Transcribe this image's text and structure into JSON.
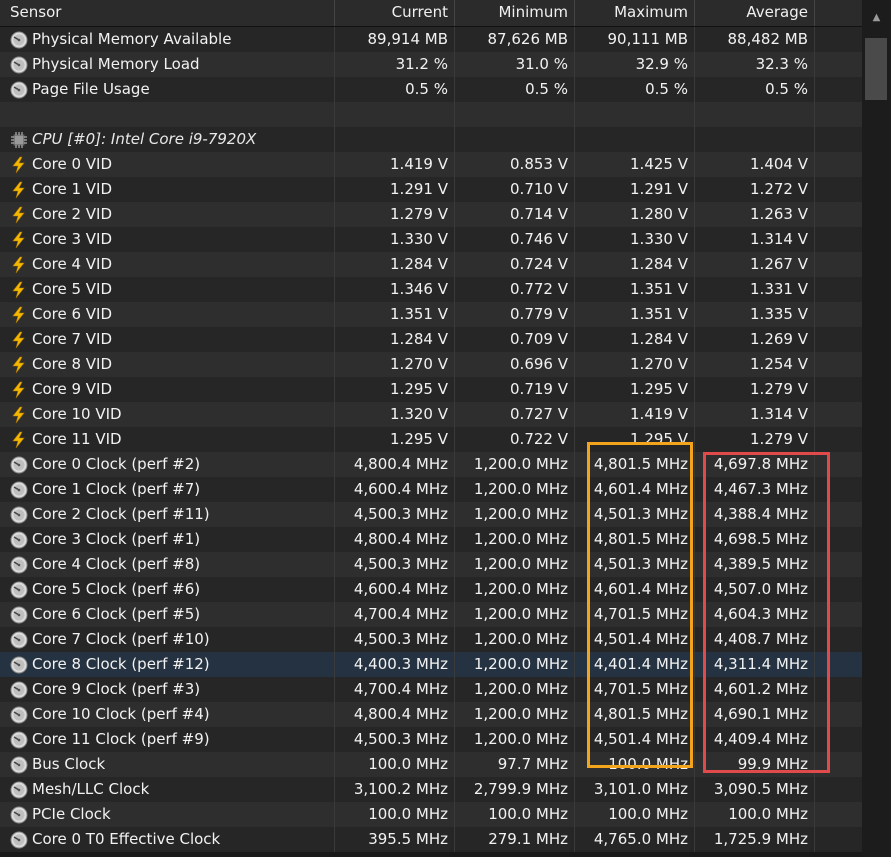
{
  "columns": {
    "sensor": "Sensor",
    "current": "Current",
    "minimum": "Minimum",
    "maximum": "Maximum",
    "average": "Average"
  },
  "colors": {
    "highlight_max": "#f2a51c",
    "highlight_avg": "#e04a4a",
    "selected_row": "#253241"
  },
  "rows": [
    {
      "icon": "gauge-icon",
      "label": "Physical Memory Available",
      "current": "89,914 MB",
      "minimum": "87,626 MB",
      "maximum": "90,111 MB",
      "average": "88,482 MB"
    },
    {
      "icon": "gauge-icon",
      "label": "Physical Memory Load",
      "current": "31.2 %",
      "minimum": "31.0 %",
      "maximum": "32.9 %",
      "average": "32.3 %"
    },
    {
      "icon": "gauge-icon",
      "label": "Page File Usage",
      "current": "0.5 %",
      "minimum": "0.5 %",
      "maximum": "0.5 %",
      "average": "0.5 %"
    },
    {
      "icon": "",
      "label": "",
      "current": "",
      "minimum": "",
      "maximum": "",
      "average": ""
    },
    {
      "icon": "chip-icon",
      "label": "CPU [#0]: Intel Core i9-7920X",
      "current": "",
      "minimum": "",
      "maximum": "",
      "average": "",
      "group": true
    },
    {
      "icon": "bolt-icon",
      "label": "Core 0 VID",
      "current": "1.419 V",
      "minimum": "0.853 V",
      "maximum": "1.425 V",
      "average": "1.404 V"
    },
    {
      "icon": "bolt-icon",
      "label": "Core 1 VID",
      "current": "1.291 V",
      "minimum": "0.710 V",
      "maximum": "1.291 V",
      "average": "1.272 V"
    },
    {
      "icon": "bolt-icon",
      "label": "Core 2 VID",
      "current": "1.279 V",
      "minimum": "0.714 V",
      "maximum": "1.280 V",
      "average": "1.263 V"
    },
    {
      "icon": "bolt-icon",
      "label": "Core 3 VID",
      "current": "1.330 V",
      "minimum": "0.746 V",
      "maximum": "1.330 V",
      "average": "1.314 V"
    },
    {
      "icon": "bolt-icon",
      "label": "Core 4 VID",
      "current": "1.284 V",
      "minimum": "0.724 V",
      "maximum": "1.284 V",
      "average": "1.267 V"
    },
    {
      "icon": "bolt-icon",
      "label": "Core 5 VID",
      "current": "1.346 V",
      "minimum": "0.772 V",
      "maximum": "1.351 V",
      "average": "1.331 V"
    },
    {
      "icon": "bolt-icon",
      "label": "Core 6 VID",
      "current": "1.351 V",
      "minimum": "0.779 V",
      "maximum": "1.351 V",
      "average": "1.335 V"
    },
    {
      "icon": "bolt-icon",
      "label": "Core 7 VID",
      "current": "1.284 V",
      "minimum": "0.709 V",
      "maximum": "1.284 V",
      "average": "1.269 V"
    },
    {
      "icon": "bolt-icon",
      "label": "Core 8 VID",
      "current": "1.270 V",
      "minimum": "0.696 V",
      "maximum": "1.270 V",
      "average": "1.254 V"
    },
    {
      "icon": "bolt-icon",
      "label": "Core 9 VID",
      "current": "1.295 V",
      "minimum": "0.719 V",
      "maximum": "1.295 V",
      "average": "1.279 V"
    },
    {
      "icon": "bolt-icon",
      "label": "Core 10 VID",
      "current": "1.320 V",
      "minimum": "0.727 V",
      "maximum": "1.419 V",
      "average": "1.314 V"
    },
    {
      "icon": "bolt-icon",
      "label": "Core 11 VID",
      "current": "1.295 V",
      "minimum": "0.722 V",
      "maximum": "1.295 V",
      "average": "1.279 V"
    },
    {
      "icon": "gauge-icon",
      "label": "Core 0 Clock (perf #2)",
      "current": "4,800.4 MHz",
      "minimum": "1,200.0 MHz",
      "maximum": "4,801.5 MHz",
      "average": "4,697.8 MHz"
    },
    {
      "icon": "gauge-icon",
      "label": "Core 1 Clock (perf #7)",
      "current": "4,600.4 MHz",
      "minimum": "1,200.0 MHz",
      "maximum": "4,601.4 MHz",
      "average": "4,467.3 MHz"
    },
    {
      "icon": "gauge-icon",
      "label": "Core 2 Clock (perf #11)",
      "current": "4,500.3 MHz",
      "minimum": "1,200.0 MHz",
      "maximum": "4,501.3 MHz",
      "average": "4,388.4 MHz"
    },
    {
      "icon": "gauge-icon",
      "label": "Core 3 Clock (perf #1)",
      "current": "4,800.4 MHz",
      "minimum": "1,200.0 MHz",
      "maximum": "4,801.5 MHz",
      "average": "4,698.5 MHz"
    },
    {
      "icon": "gauge-icon",
      "label": "Core 4 Clock (perf #8)",
      "current": "4,500.3 MHz",
      "minimum": "1,200.0 MHz",
      "maximum": "4,501.3 MHz",
      "average": "4,389.5 MHz"
    },
    {
      "icon": "gauge-icon",
      "label": "Core 5 Clock (perf #6)",
      "current": "4,600.4 MHz",
      "minimum": "1,200.0 MHz",
      "maximum": "4,601.4 MHz",
      "average": "4,507.0 MHz"
    },
    {
      "icon": "gauge-icon",
      "label": "Core 6 Clock (perf #5)",
      "current": "4,700.4 MHz",
      "minimum": "1,200.0 MHz",
      "maximum": "4,701.5 MHz",
      "average": "4,604.3 MHz"
    },
    {
      "icon": "gauge-icon",
      "label": "Core 7 Clock (perf #10)",
      "current": "4,500.3 MHz",
      "minimum": "1,200.0 MHz",
      "maximum": "4,501.4 MHz",
      "average": "4,408.7 MHz"
    },
    {
      "icon": "gauge-icon",
      "label": "Core 8 Clock (perf #12)",
      "current": "4,400.3 MHz",
      "minimum": "1,200.0 MHz",
      "maximum": "4,401.4 MHz",
      "average": "4,311.4 MHz",
      "selected": true
    },
    {
      "icon": "gauge-icon",
      "label": "Core 9 Clock (perf #3)",
      "current": "4,700.4 MHz",
      "minimum": "1,200.0 MHz",
      "maximum": "4,701.5 MHz",
      "average": "4,601.2 MHz"
    },
    {
      "icon": "gauge-icon",
      "label": "Core 10 Clock (perf #4)",
      "current": "4,800.4 MHz",
      "minimum": "1,200.0 MHz",
      "maximum": "4,801.5 MHz",
      "average": "4,690.1 MHz"
    },
    {
      "icon": "gauge-icon",
      "label": "Core 11 Clock (perf #9)",
      "current": "4,500.3 MHz",
      "minimum": "1,200.0 MHz",
      "maximum": "4,501.4 MHz",
      "average": "4,409.4 MHz"
    },
    {
      "icon": "gauge-icon",
      "label": "Bus Clock",
      "current": "100.0 MHz",
      "minimum": "97.7 MHz",
      "maximum": "100.0 MHz",
      "average": "99.9 MHz"
    },
    {
      "icon": "gauge-icon",
      "label": "Mesh/LLC Clock",
      "current": "3,100.2 MHz",
      "minimum": "2,799.9 MHz",
      "maximum": "3,101.0 MHz",
      "average": "3,090.5 MHz"
    },
    {
      "icon": "gauge-icon",
      "label": "PCIe Clock",
      "current": "100.0 MHz",
      "minimum": "100.0 MHz",
      "maximum": "100.0 MHz",
      "average": "100.0 MHz"
    },
    {
      "icon": "gauge-icon",
      "label": "Core 0 T0 Effective Clock",
      "current": "395.5 MHz",
      "minimum": "279.1 MHz",
      "maximum": "4,765.0 MHz",
      "average": "1,725.9 MHz"
    }
  ]
}
